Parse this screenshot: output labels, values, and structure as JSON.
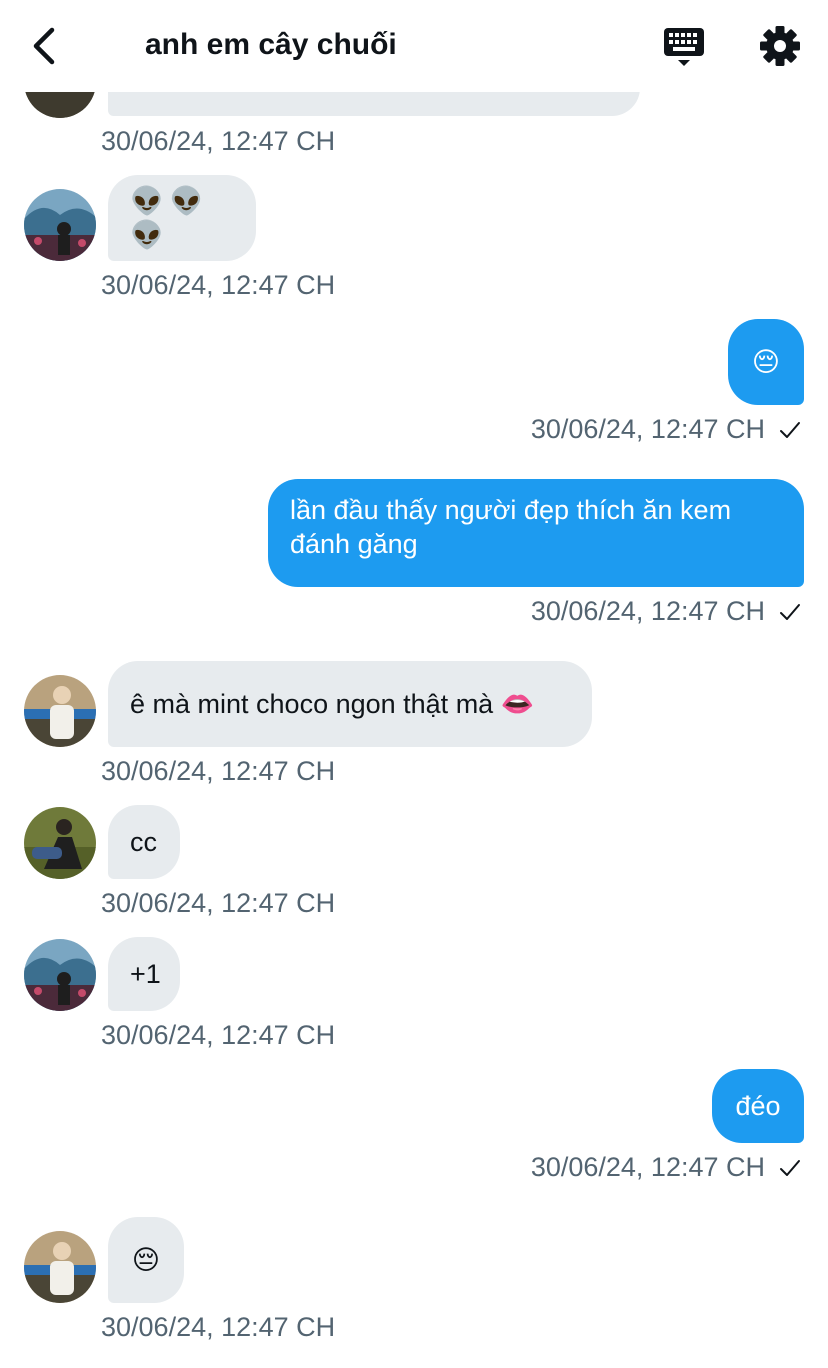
{
  "header": {
    "title": "anh em cây chuối",
    "back_icon": "chevron-left-icon",
    "keyboard_icon": "keyboard-icon",
    "settings_icon": "gear-icon"
  },
  "colors": {
    "sent_bubble": "#1d9bf0",
    "received_bubble": "#e7ebee",
    "timestamp": "#536471"
  },
  "messages": [
    {
      "direction": "received",
      "text": "",
      "timestamp": "30/06/24, 12:47 CH",
      "partial": true
    },
    {
      "direction": "received",
      "text": "👽👽👽",
      "timestamp": "30/06/24, 12:47 CH"
    },
    {
      "direction": "sent",
      "text": "😔",
      "timestamp": "30/06/24, 12:47 CH",
      "status": "sent"
    },
    {
      "direction": "sent",
      "text": "lần đầu thấy người đẹp thích ăn kem đánh găng",
      "timestamp": "30/06/24, 12:47 CH",
      "status": "sent"
    },
    {
      "direction": "received",
      "text": "ê mà mint choco ngon thật mà 👄",
      "timestamp": "30/06/24, 12:47 CH"
    },
    {
      "direction": "received",
      "text": "cc",
      "timestamp": "30/06/24, 12:47 CH"
    },
    {
      "direction": "received",
      "text": "+1",
      "timestamp": "30/06/24, 12:47 CH"
    },
    {
      "direction": "sent",
      "text": "đéo",
      "timestamp": "30/06/24, 12:47 CH",
      "status": "sent"
    },
    {
      "direction": "received",
      "text": "😔",
      "timestamp": "30/06/24, 12:47 CH"
    }
  ]
}
